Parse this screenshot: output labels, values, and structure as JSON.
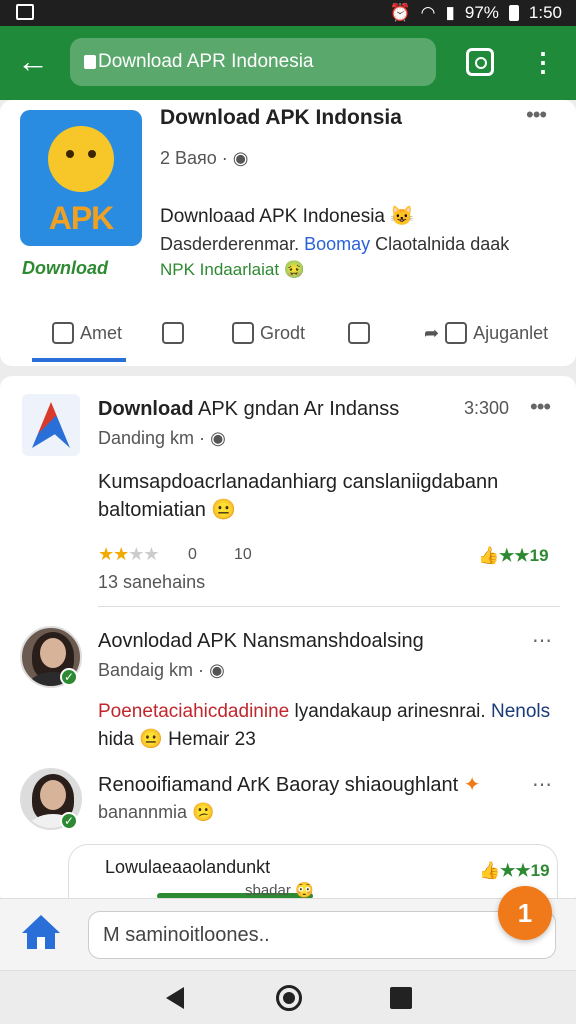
{
  "status_bar": {
    "battery": "97%",
    "time": "1:50"
  },
  "appbar": {
    "url_text": "Download APR Indonesia"
  },
  "card1": {
    "app_logo_text": "APK",
    "download_caption": "Download",
    "title": "Download APK Indonsia",
    "meta": "2 Bаяо ·",
    "headline": "Downloaad APK Indonesia",
    "desc_prefix": "Dasderderenmar. ",
    "desc_blue": "Boomay",
    "desc_suffix": " Claotalnida daak",
    "green_line": "NPK Indaarlaiat",
    "actions": {
      "like": "Amet",
      "share2": "",
      "comment": "Grodt",
      "save": "",
      "more": "Ajuganlet"
    }
  },
  "post": {
    "title_bold": "Download",
    "title_rest": " APK gndan Ar Indanss",
    "time": "3:300",
    "sub": "Danding km ·",
    "body": "Kumsapdoacrlanadanhiarg canslaniigdabann baltomiatian",
    "rating_num_1": "0",
    "rating_num_2": "10",
    "green_rating": "19",
    "views": "13 sanehains"
  },
  "comments": [
    {
      "title": "Aovnlodad APK Nansmanshdoalsing",
      "sub": "Bandaig km ·",
      "body_red": "Poenetaciahicdadinine",
      "body_black": " lyandakaup arinesnrai. ",
      "body_dark": "Nenols",
      "body_line2": "hida",
      "body_line2_b": " Hemair 23"
    },
    {
      "title": "Renooifiamand ArK Baoray shiaoughlant",
      "sub": "banannmia"
    }
  ],
  "reply": {
    "text": "Lowulaeaaolandunkt",
    "sub": "sbadar",
    "rate": "19"
  },
  "composer": {
    "placeholder": "M saminoitloones.."
  },
  "fab_label": "1",
  "colors": {
    "appbar": "#1f8a3a",
    "accent": "#2a6fd8",
    "green": "#2d8a32",
    "fab": "#f07a1a"
  }
}
